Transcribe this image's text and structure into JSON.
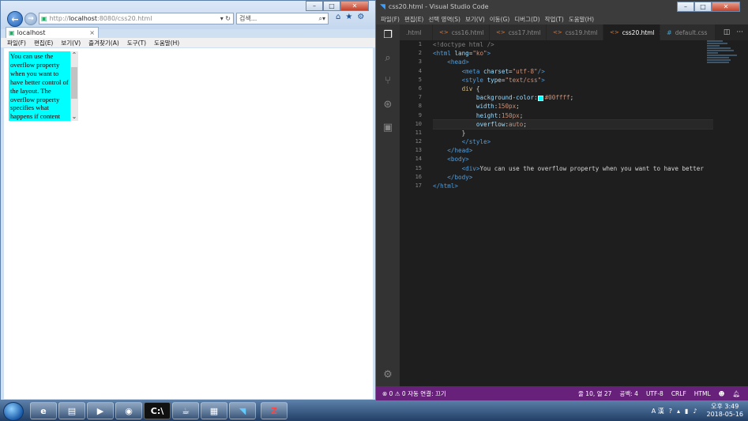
{
  "ie": {
    "url_host": "localhost",
    "url_prefix": "http://",
    "url_rest": ":8080/css20.html",
    "search_placeholder": "검색...",
    "tab_title": "localhost",
    "tab_close": "×",
    "menu": [
      "파일(F)",
      "편집(E)",
      "보기(V)",
      "즐겨찾기(A)",
      "도구(T)",
      "도움말(H)"
    ],
    "page_text": "You can use the overflow property when you want to have better control of the layout. The overflow property specifies what happens if content"
  },
  "vscode": {
    "title": "css20.html - Visual Studio Code",
    "menu": [
      "파일(F)",
      "편집(E)",
      "선택 영역(S)",
      "보기(V)",
      "이동(G)",
      "디버그(D)",
      "작업(T)",
      "도움말(H)"
    ],
    "tabs": [
      {
        "label": ".html",
        "active": false
      },
      {
        "label": "css16.html",
        "active": false
      },
      {
        "label": "css17.html",
        "active": false
      },
      {
        "label": "css19.html",
        "active": false
      },
      {
        "label": "css20.html",
        "active": true
      },
      {
        "label": "default.css",
        "active": false
      }
    ],
    "line_numbers": [
      "1",
      "2",
      "3",
      "4",
      "5",
      "6",
      "7",
      "8",
      "9",
      "10",
      "11",
      "12",
      "13",
      "14",
      "15",
      "16",
      "17"
    ],
    "code": {
      "l1_tag": "<!doctype html />",
      "l2_open": "<html",
      "l2_attr": "lang",
      "l2_val": "\"ko\"",
      "l2_close": ">",
      "l3": "<head>",
      "l4_open": "<meta",
      "l4_attr": "charset",
      "l4_val": "\"utf-8\"",
      "l4_close": "/>",
      "l5_open": "<style",
      "l5_attr": "type",
      "l5_val": "\"text/css\"",
      "l5_close": ">",
      "l6_sel": "div",
      "l6_brace": " {",
      "l7_prop": "background-color",
      "l7_val": "#00ffff",
      "l8_prop": "width",
      "l8_val": "150px",
      "l9_prop": "height",
      "l9_val": "150px",
      "l10_prop": "overflow",
      "l10_val": "auto",
      "l11": "}",
      "l12": "</style>",
      "l13": "</head>",
      "l14": "<body>",
      "l15_open": "<div>",
      "l15_text": "You can use the overflow property when you want to have better",
      "l16": "</body>",
      "l17": "</html>"
    },
    "status_left": "⊗ 0 ⚠ 0   자동 연결: 끄기",
    "status": {
      "position": "줄 10, 열 27",
      "spaces": "공백: 4",
      "encoding": "UTF-8",
      "eol": "CRLF",
      "language": "HTML"
    }
  },
  "taskbar": {
    "clock_time": "오후 3:49",
    "clock_date": "2018-05-16",
    "ime": "A 漢"
  }
}
